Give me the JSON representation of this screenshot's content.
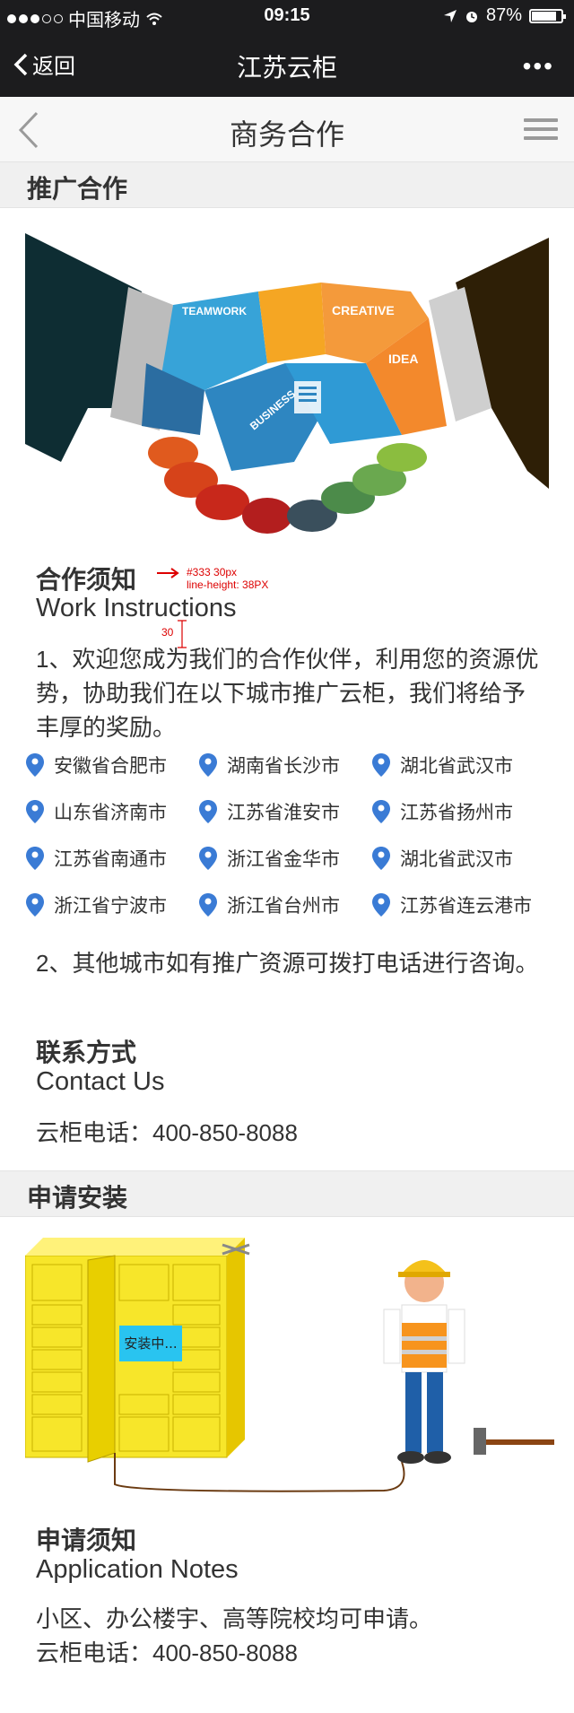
{
  "status": {
    "carrier": "中国移动",
    "time": "09:15",
    "battery": "87%"
  },
  "nav": {
    "back_label": "返回",
    "title": "江苏云柜",
    "more_label": "•••"
  },
  "page": {
    "title": "商务合作"
  },
  "promo_section": {
    "heading": "推广合作",
    "notice_title": "合作须知",
    "notice_title_en": "Work Instructions",
    "annotation_style": "#333 30px",
    "annotation_lineheight": "line-height: 38PX",
    "annotation_spacing": "30",
    "para1": "1、欢迎您成为我们的合作伙伴，利用您的资源优势，协助我们在以下城市推广云柜，我们将给予丰厚的奖励。",
    "cities": [
      "安徽省合肥市",
      "湖南省长沙市",
      "湖北省武汉市",
      "山东省济南市",
      "江苏省淮安市",
      "江苏省扬州市",
      "江苏省南通市",
      "浙江省金华市",
      "湖北省武汉市",
      "浙江省宁波市",
      "浙江省台州市",
      "江苏省连云港市"
    ],
    "para2": "2、其他城市如有推广资源可拨打电话进行咨询。",
    "contact_title": "联系方式",
    "contact_title_en": "Contact Us",
    "contact_phone": "云柜电话：400-850-8088"
  },
  "handshake_image": {
    "teamwork": "TEAMWORK",
    "creative": "CREATIVE",
    "idea": "IDEA",
    "business": "BUSINESS"
  },
  "install_section": {
    "heading": "申请安装",
    "locker_status": "安装中...",
    "notes_title": "申请须知",
    "notes_title_en": "Application Notes",
    "notes_line1": "小区、办公楼宇、高等院校均可申请。",
    "notes_line2": "云柜电话：400-850-8088"
  },
  "colors": {
    "pin": "#3a7bd5",
    "accent_red": "#d00000",
    "locker_yellow": "#f7e62a"
  }
}
